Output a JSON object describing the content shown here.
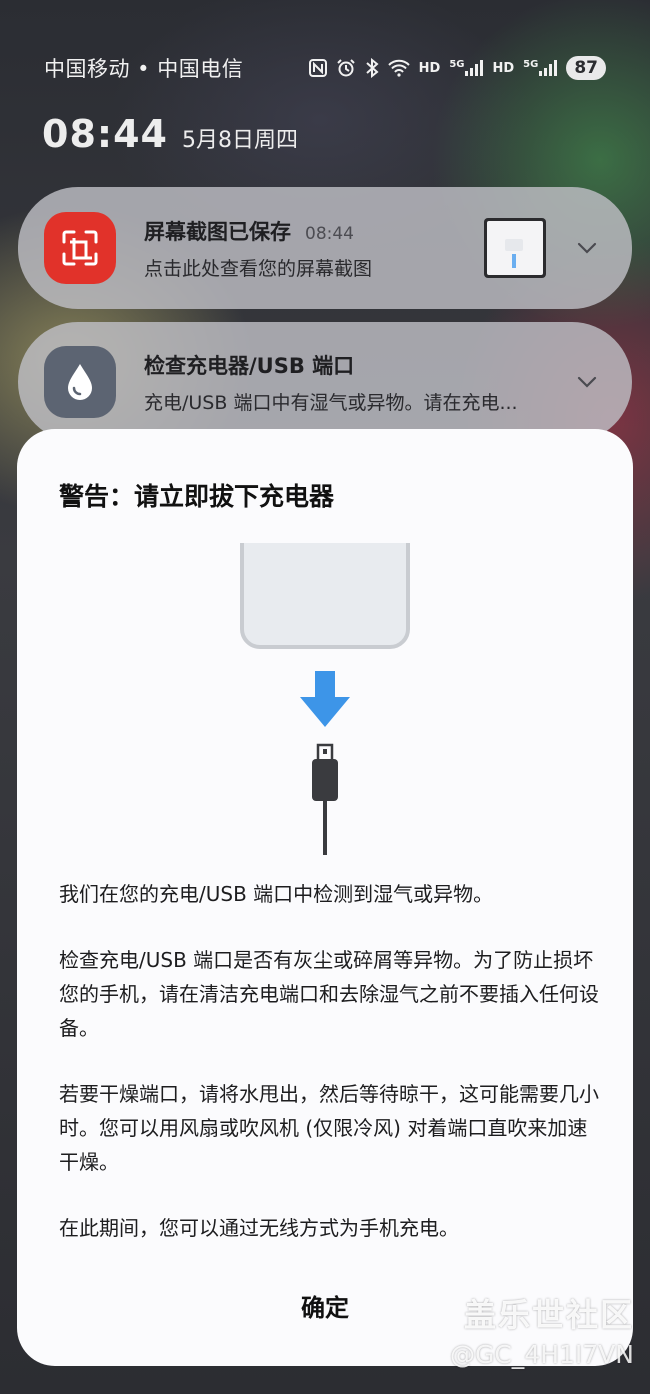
{
  "status_bar": {
    "carrier": "中国移动 • 中国电信",
    "hd1": "HD",
    "fiveg1": "5G",
    "hd2": "HD",
    "fiveg2": "5G",
    "battery": "87",
    "icons": [
      "nfc-icon",
      "alarm-icon",
      "bluetooth-icon",
      "wifi-icon",
      "signal-icon",
      "signal-icon"
    ]
  },
  "lockscreen": {
    "time": "08:44",
    "date": "5月8日周四"
  },
  "notifications": [
    {
      "title": "屏幕截图已保存",
      "time": "08:44",
      "body": "点击此处查看您的屏幕截图",
      "icon": "screenshot-icon",
      "icon_color": "#e1322a"
    },
    {
      "title": "检查充电器/USB 端口",
      "body": "充电/USB 端口中有湿气或异物。请在充电...",
      "icon": "water-drop-icon",
      "icon_color": "#5c6472"
    }
  ],
  "dialog": {
    "title": "警告：请立即拔下充电器",
    "paragraphs": [
      "我们在您的充电/USB 端口中检测到湿气或异物。",
      "检查充电/USB 端口是否有灰尘或碎屑等异物。为了防止损坏您的手机，请在清洁充电端口和去除湿气之前不要插入任何设备。",
      "若要干燥端口，请将水甩出，然后等待晾干，这可能需要几小时。您可以用风扇或吹风机 (仅限冷风) 对着端口直吹来加速干燥。",
      "在此期间，您可以通过无线方式为手机充电。"
    ],
    "confirm_label": "确定",
    "arrow_color": "#3d95e8"
  },
  "watermark": {
    "line1": "盖乐世社区",
    "line2": "@GC_4H1I7VN"
  }
}
